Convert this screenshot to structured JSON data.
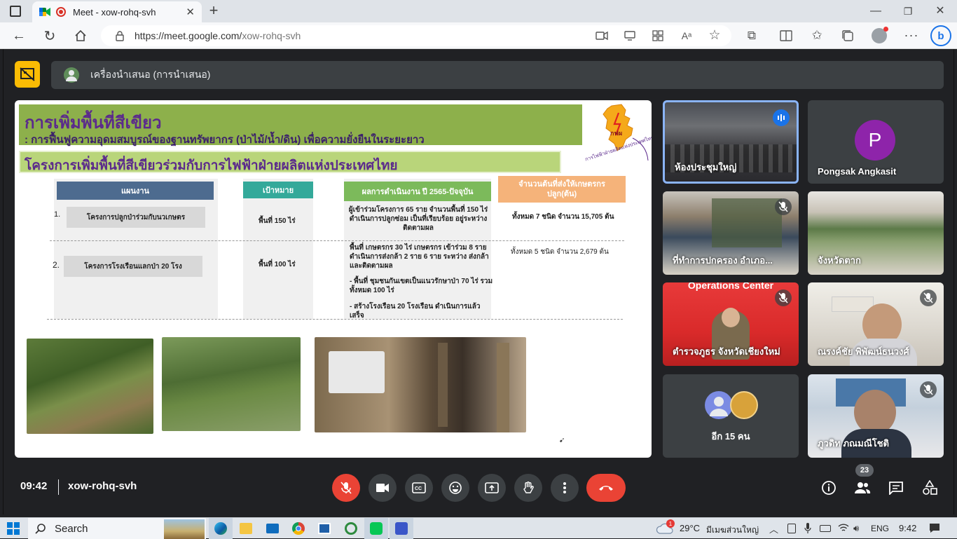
{
  "browser": {
    "tab_title": "Meet - xow-rohq-svh",
    "url_prefix": "https://meet.google.com/",
    "url_path": "xow-rohq-svh"
  },
  "meet": {
    "presenter_banner": "เครื่องนำเสนอ (การนำเสนอ)",
    "time": "09:42",
    "meeting_code": "xow-rohq-svh",
    "people_count": "23"
  },
  "slide": {
    "title": "การเพิ่มพื้นที่สีเขียว",
    "subtitle": ": การฟื้นฟูความอุดมสมบูรณ์ของฐานทรัพยากร (ป่าไม้/น้ำ/ดิน) เพื่อความยั่งยืนในระยะยาว",
    "project_title": "โครงการเพิ่มพื้นที่สีเขียวร่วมกับการไฟฟ้าฝ่ายผลิตแห่งประเทศไทย",
    "logo_caption": "การไฟฟ้าฝ่ายผลิตแห่งประเทศไทย",
    "logo_abbr": "กฟผ",
    "headers": {
      "plan": "แผนงาน",
      "target": "เป้าหมาย",
      "result": "ผลการดำเนินงาน ปี 2565-ปัจจุบัน",
      "seedlings": "จำนวนต้นที่ส่งให้เกษตรกรปลูก(ต้น)"
    },
    "rows": [
      {
        "num": "1.",
        "plan": "โครงการปลูกป่าร่วมกับนวเกษตร",
        "target": "พื้นที่ 150 ไร่",
        "result": "ผู้เข้าร่วมโครงการ 65 ราย จำนวนพื้นที่ 150 ไร่ ดำเนินการปลูกซ่อม เป็นที่เรียบร้อย อยู่ระหว่างติดตามผล",
        "seedlings": "ทั้งหมด 7 ชนิด จำนวน 15,705 ต้น"
      },
      {
        "num": "2.",
        "plan": "โครงการโรงเรือนแลกป่า 20 โรง",
        "target": "พื้นที่ 100 ไร่",
        "result_lines": [
          "พื้นที่ เกษตรกร 30 ไร่ เกษตรกร เข้าร่วม 8 ราย ดำเนินการส่งกล้า 2 ราย 6 ราย ระหว่าง ส่งกล้า และติดตามผล",
          "- พื้นที่ ชุมชนกันเขตเป็นแนวรักษาป่า 70 ไร่ รวมทั้งหมด 100 ไร่",
          "- สร้างโรงเรือน 20 โรงเรือน ดำเนินการแล้ว เสร็จ"
        ],
        "seedlings": "ทั้งหมด 5 ชนิด จำนวน 2,679 ต้น"
      }
    ]
  },
  "participants": [
    {
      "name": "ห้องประชุมใหญ่",
      "speaking": true
    },
    {
      "name": "Pongsak Angkasit",
      "initial": "P"
    },
    {
      "name": "ที่ทำการปกครอง อำเภอ...",
      "muted": true
    },
    {
      "name": "จังหวัดตาก"
    },
    {
      "name": "ตำรวจภูธร จังหวัดเชียงใหม่",
      "muted": true,
      "banner": "Operations Center"
    },
    {
      "name": "ณรงค์ชัย พิพัฒน์ธนวงศ์",
      "muted": true
    },
    {
      "name": "อีก 15 คน"
    },
    {
      "name": "ภูวดิท ภณมณีโชติ",
      "muted": true
    }
  ],
  "taskbar": {
    "search": "Search",
    "weather_temp": "29°C",
    "weather_desc": "มีเมฆส่วนใหญ่",
    "weather_badge": "1",
    "lang": "ENG",
    "clock": "9:42"
  },
  "colors": {
    "end_call": "#ea4335",
    "mic_off": "#ea4335",
    "speaking_border": "#8ab4f8",
    "presenter_icon": "#fbbc04",
    "avatar_p": "#8e24aa",
    "slide_green": "#8db04b",
    "slide_purple": "#5b2a8c",
    "header_blue": "#4d6b8f",
    "header_teal": "#34a99a",
    "header_green": "#7cba5b",
    "header_orange": "#f5b37a"
  }
}
